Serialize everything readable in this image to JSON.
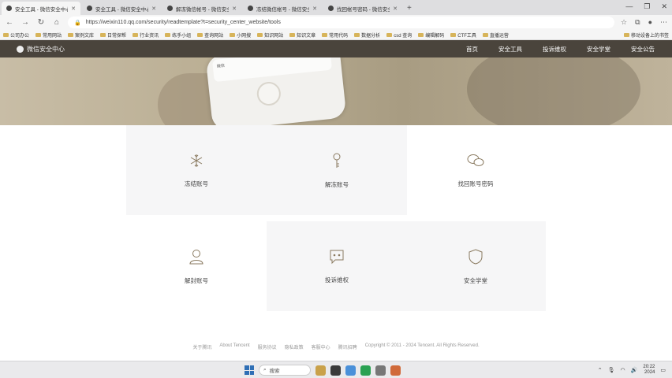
{
  "browser": {
    "tabs": [
      {
        "title": "安全工具 - 微信安全中心 - 安",
        "active": true
      },
      {
        "title": "安全工具 - 微信安全中心 - 安",
        "active": false
      },
      {
        "title": "解冻微信帐号 - 微信安全中心",
        "active": false
      },
      {
        "title": "冻结微信帐号 - 微信安全中心",
        "active": false
      },
      {
        "title": "找回帐号密码 - 微信安全中心",
        "active": false
      }
    ],
    "new_tab": "+",
    "url": "https://weixin110.qq.com/security/readtemplate?t=security_center_website/tools",
    "bookmarks": [
      "公司办公",
      "常用网站",
      "案例文库",
      "日常探帮",
      "行业资讯",
      "练手小组",
      "查询网站",
      "小网搜",
      "知识网站",
      "知识文章",
      "常用代码",
      "数据分析",
      "csd 查询",
      "编辑解码",
      "CTF工具",
      "直播运营"
    ],
    "mobile_bookmarks": "移动设备上的书签"
  },
  "site": {
    "logo": "微信安全中心",
    "nav": [
      "首页",
      "安全工具",
      "投诉维权",
      "安全学堂",
      "安全公告"
    ],
    "hero_app_label": "微信"
  },
  "tools": [
    {
      "label": "冻结账号",
      "icon": "snowflake-icon"
    },
    {
      "label": "解冻账号",
      "icon": "key-icon"
    },
    {
      "label": "找回账号密码",
      "icon": "chat-bubbles-icon"
    },
    {
      "label": "解封账号",
      "icon": "user-icon"
    },
    {
      "label": "投诉维权",
      "icon": "complaint-icon"
    },
    {
      "label": "安全学堂",
      "icon": "shield-icon"
    }
  ],
  "footer": [
    "关于腾讯",
    "About Tencent",
    "服务协议",
    "隐私政策",
    "客服中心",
    "腾讯招聘",
    "Copyright © 2011 - 2024 Tencent. All Rights Reserved."
  ],
  "taskbar": {
    "search_placeholder": "搜索",
    "time": "20:22",
    "date": "2024"
  }
}
